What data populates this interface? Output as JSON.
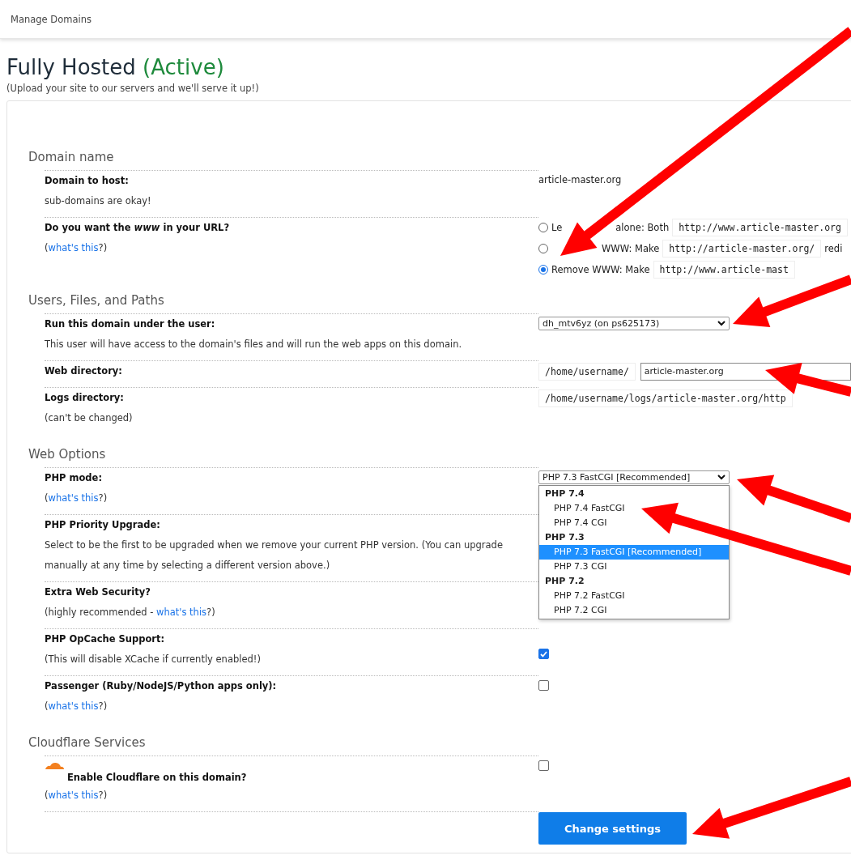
{
  "header": {
    "breadcrumb": "Manage Domains"
  },
  "title": {
    "text": "Fully Hosted",
    "status": "(Active)",
    "subtitle": "(Upload your site to our servers and we'll serve it up!)"
  },
  "sections": [
    {
      "heading": "Domain name",
      "rows": [
        {
          "kind": "text",
          "label": "Domain to host:",
          "note": "sub-domains are okay!",
          "value": "article-master.org"
        },
        {
          "kind": "radios",
          "label": "Do you want the *www* in your URL?",
          "help": {
            "before": "(",
            "link": "what's this",
            "after": "?)"
          },
          "options": [
            {
              "label_parts": [
                "Le",
                "alone: Both"
              ],
              "url": "http://www.article-master.org",
              "selected": false
            },
            {
              "label_parts": [
                "WWW: Make"
              ],
              "covered_start": true,
              "url": "http://article-master.org/",
              "after": "redi",
              "selected": false
            },
            {
              "label_parts": [
                "Remove WWW: Make"
              ],
              "url": "http://www.article-mast",
              "selected": true
            }
          ]
        }
      ]
    },
    {
      "heading": "Users, Files, and Paths",
      "rows": [
        {
          "kind": "select",
          "label": "Run this domain under the user:",
          "note": "This user will have access to the domain's files and will run the web apps on this domain.",
          "value": "dh_mtv6yz (on ps625173)"
        },
        {
          "kind": "path",
          "label": "Web directory:",
          "prefix": "/home/username/",
          "value": "article-master.org"
        },
        {
          "kind": "fixed",
          "label": "Logs directory:",
          "note": "(can't be changed)",
          "value": "/home/username/logs/article-master.org/http"
        }
      ]
    },
    {
      "heading": "Web Options",
      "rows": [
        {
          "kind": "select",
          "label": "PHP mode:",
          "help": {
            "before": "(",
            "link": "what's this",
            "after": "?)"
          },
          "value": "PHP 7.3 FastCGI [Recommended]",
          "open": true,
          "groups": [
            {
              "label": "PHP 7.4",
              "options": [
                {
                  "label": "PHP 7.4 FastCGI",
                  "selected": false
                },
                {
                  "label": "PHP 7.4 CGI",
                  "selected": false
                }
              ]
            },
            {
              "label": "PHP 7.3",
              "options": [
                {
                  "label": "PHP 7.3 FastCGI [Recommended]",
                  "selected": true
                },
                {
                  "label": "PHP 7.3 CGI",
                  "selected": false
                }
              ]
            },
            {
              "label": "PHP 7.2",
              "options": [
                {
                  "label": "PHP 7.2 FastCGI",
                  "selected": false
                },
                {
                  "label": "PHP 7.2 CGI",
                  "selected": false
                }
              ]
            }
          ]
        },
        {
          "kind": "plain",
          "label": "PHP Priority Upgrade:",
          "note": "Select to be the first to be upgraded when we remove your current PHP version. (You can upgrade manually at any time by selecting a different version above.)"
        },
        {
          "kind": "plain",
          "label": "Extra Web Security?",
          "help": {
            "before": "(highly recommended - ",
            "link": "what's this",
            "after": "?)"
          }
        },
        {
          "kind": "checkbox",
          "label": "PHP OpCache Support:",
          "note": "(This will disable XCache if currently enabled!)",
          "checked": true
        },
        {
          "kind": "checkbox",
          "label": "Passenger (Ruby/NodeJS/Python apps only):",
          "help": {
            "before": "(",
            "link": "what's this",
            "after": "?)"
          },
          "checked": false
        }
      ]
    },
    {
      "heading": "Cloudflare Services",
      "rows": [
        {
          "kind": "checkbox",
          "label": "Enable Cloudflare on this domain?",
          "help": {
            "before": "(",
            "link": "what's this",
            "after": "?)"
          },
          "checked": false,
          "logo": true
        }
      ]
    }
  ],
  "submit": "Change settings"
}
